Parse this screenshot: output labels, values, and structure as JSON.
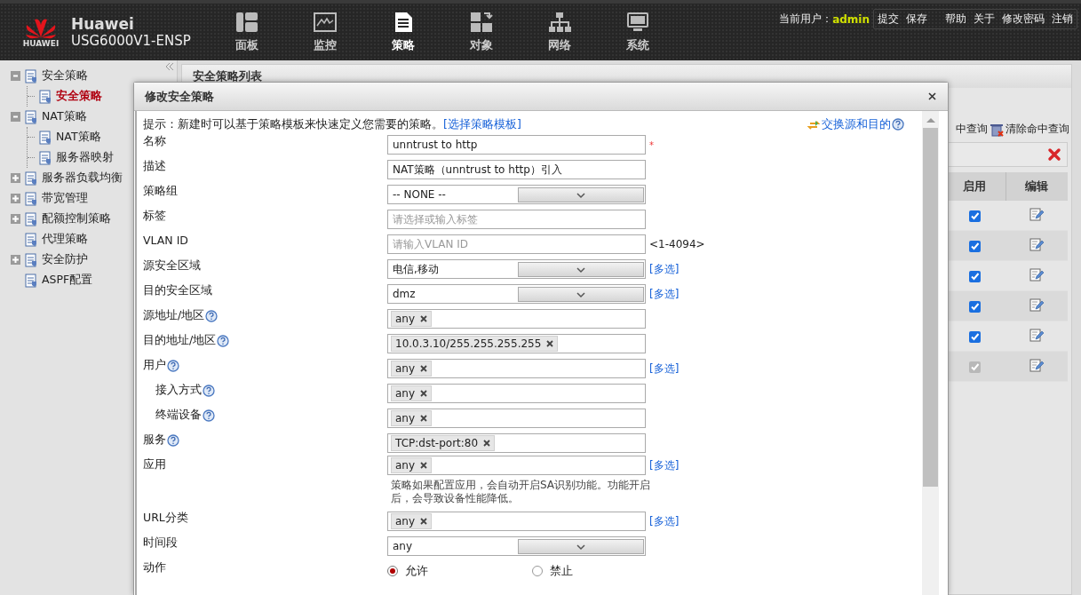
{
  "header": {
    "logo_text": "HUAWEI",
    "brand": "Huawei",
    "model": "USG6000V1-ENSP",
    "nav": [
      {
        "label": "面板",
        "selected": false
      },
      {
        "label": "监控",
        "selected": false
      },
      {
        "label": "策略",
        "selected": true
      },
      {
        "label": "对象",
        "selected": false
      },
      {
        "label": "网络",
        "selected": false
      },
      {
        "label": "系统",
        "selected": false
      }
    ],
    "user_label": "当前用户：",
    "user": "admin",
    "links": [
      "提交",
      "保存",
      "帮助",
      "关于",
      "修改密码",
      "注销"
    ]
  },
  "sidebar": {
    "items": [
      {
        "label": "安全策略",
        "expanded": true,
        "selected": false,
        "children": [
          {
            "label": "安全策略",
            "selected": true
          }
        ]
      },
      {
        "label": "NAT策略",
        "expanded": true,
        "selected": false,
        "children": [
          {
            "label": "NAT策略",
            "selected": false
          },
          {
            "label": "服务器映射",
            "selected": false
          }
        ]
      },
      {
        "label": "服务器负载均衡",
        "expanded": false,
        "selected": false
      },
      {
        "label": "带宽管理",
        "expanded": false,
        "selected": false
      },
      {
        "label": "配额控制策略",
        "expanded": false,
        "selected": false
      },
      {
        "label": "代理策略",
        "selected": false
      },
      {
        "label": "安全防护",
        "expanded": false,
        "selected": false
      },
      {
        "label": "ASPF配置",
        "selected": false
      }
    ]
  },
  "policy_list": {
    "title": "安全策略列表",
    "toolbar": [
      "中查询",
      "清除命中查询"
    ],
    "columns": [
      "启用",
      "编辑"
    ],
    "rows": [
      {
        "enabled": true,
        "disabled": false
      },
      {
        "enabled": true,
        "disabled": false
      },
      {
        "enabled": true,
        "disabled": false
      },
      {
        "enabled": true,
        "disabled": false
      },
      {
        "enabled": true,
        "disabled": false
      },
      {
        "enabled": true,
        "disabled": true
      }
    ]
  },
  "dialog": {
    "title": "修改安全策略",
    "hint": "提示：新建时可以基于策略模板来快速定义您需要的策略。",
    "template_link": "[选择策略模板]",
    "swap_link": "交换源和目的",
    "fields": [
      {
        "label": "名称",
        "kind": "text",
        "value": "unntrust to http",
        "required_mark": "*"
      },
      {
        "label": "描述",
        "kind": "text",
        "value": "NAT策略（unntrust to http）引入"
      },
      {
        "label": "策略组",
        "kind": "select",
        "value": "-- NONE --"
      },
      {
        "label": "标签",
        "kind": "text",
        "placeholder": "请选择或输入标签"
      },
      {
        "label": "VLAN ID",
        "kind": "text",
        "placeholder": "请输入VLAN ID",
        "suffix": "<1-4094>"
      },
      {
        "label": "源安全区域",
        "kind": "select",
        "value": "电信,移动",
        "link": "[多选]"
      },
      {
        "label": "目的安全区域",
        "kind": "select",
        "value": "dmz",
        "link": "[多选]"
      },
      {
        "label": "源地址/地区",
        "kind": "tags",
        "tags": [
          "any"
        ],
        "help": true
      },
      {
        "label": "目的地址/地区",
        "kind": "tags",
        "tags": [
          "10.0.3.10/255.255.255.255"
        ],
        "help": true
      },
      {
        "label": "用户",
        "kind": "tags",
        "tags": [
          "any"
        ],
        "link": "[多选]",
        "help": true
      },
      {
        "label": "接入方式",
        "kind": "tags",
        "tags": [
          "any"
        ],
        "help": true,
        "indent": true
      },
      {
        "label": "终端设备",
        "kind": "tags",
        "tags": [
          "any"
        ],
        "help": true,
        "indent": true
      },
      {
        "label": "服务",
        "kind": "tags",
        "tags": [
          "TCP:dst-port:80"
        ],
        "help": true
      },
      {
        "label": "应用",
        "kind": "tags",
        "tags": [
          "any"
        ],
        "link": "[多选]",
        "note": "策略如果配置应用，会自动开启SA识别功能。功能开启后，会导致设备性能降低。"
      },
      {
        "label": "URL分类",
        "kind": "tags",
        "tags": [
          "any"
        ],
        "link": "[多选]"
      },
      {
        "label": "时间段",
        "kind": "select",
        "value": "any"
      },
      {
        "label": "动作",
        "kind": "radio",
        "options": [
          {
            "label": "允许",
            "selected": true
          },
          {
            "label": "禁止",
            "selected": false
          }
        ]
      }
    ]
  }
}
